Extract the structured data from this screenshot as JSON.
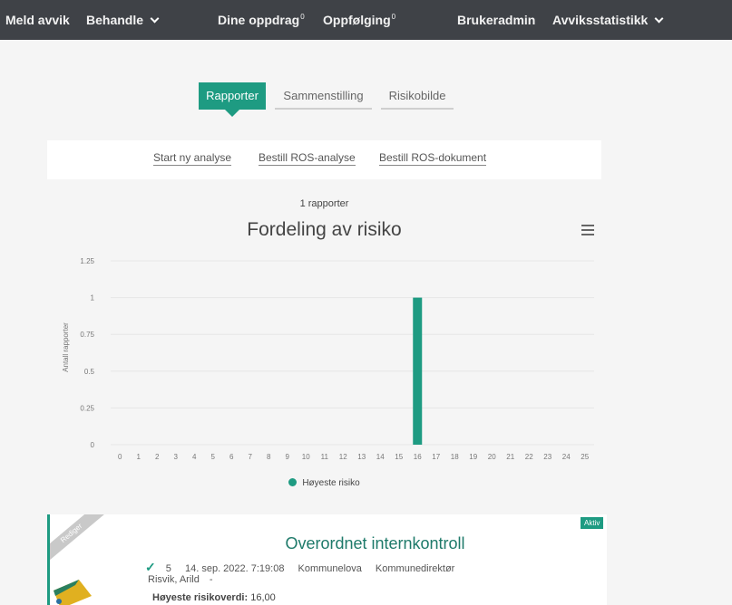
{
  "topnav": {
    "items": [
      {
        "label": "Meld avvik"
      },
      {
        "label": "Behandle",
        "dropdown": true
      },
      {
        "label": "Dine oppdrag",
        "badge": "0"
      },
      {
        "label": "Oppfølging",
        "badge": "0"
      },
      {
        "label": "Brukeradmin"
      },
      {
        "label": "Avviksstatistikk",
        "dropdown": true
      }
    ]
  },
  "tabs": [
    {
      "label": "Rapporter",
      "active": true
    },
    {
      "label": "Sammenstilling",
      "active": false
    },
    {
      "label": "Risikobilde",
      "active": false
    }
  ],
  "actions": [
    {
      "label": "Start ny analyse"
    },
    {
      "label": "Bestill ROS-analyse"
    },
    {
      "label": "Bestill ROS-dokument"
    }
  ],
  "report_count": "1 rapporter",
  "chart_data": {
    "type": "bar",
    "title": "Fordeling av risiko",
    "ylabel": "Antall rapporter",
    "xlabel": "",
    "categories": [
      "0",
      "1",
      "2",
      "3",
      "4",
      "5",
      "6",
      "7",
      "8",
      "9",
      "10",
      "11",
      "12",
      "13",
      "14",
      "15",
      "16",
      "17",
      "18",
      "19",
      "20",
      "21",
      "22",
      "23",
      "24",
      "25"
    ],
    "series": [
      {
        "name": "Høyeste risiko",
        "values": [
          0,
          0,
          0,
          0,
          0,
          0,
          0,
          0,
          0,
          0,
          0,
          0,
          0,
          0,
          0,
          0,
          1,
          0,
          0,
          0,
          0,
          0,
          0,
          0,
          0,
          0
        ]
      }
    ],
    "ylim": [
      0,
      1.25
    ],
    "yticks": [
      "0",
      "0.25",
      "0.5",
      "0.75",
      "1",
      "1.25"
    ],
    "grid": true,
    "legend": "bottom",
    "color": "#1e9b82"
  },
  "report": {
    "ribbon": "Rediger",
    "status": "Aktiv",
    "title": "Overordnet internkontroll",
    "number": "5",
    "date": "14. sep. 2022. 7:19:08",
    "law": "Kommunelova",
    "role": "Kommunedirektør",
    "person": "Risvik, Arild",
    "person_suffix": "-",
    "highest_risk_label": "Høyeste risikoverdi:",
    "highest_risk_value": "16,00"
  },
  "colors": {
    "accent": "#1e9b82",
    "nav_bg": "#3f4247"
  }
}
